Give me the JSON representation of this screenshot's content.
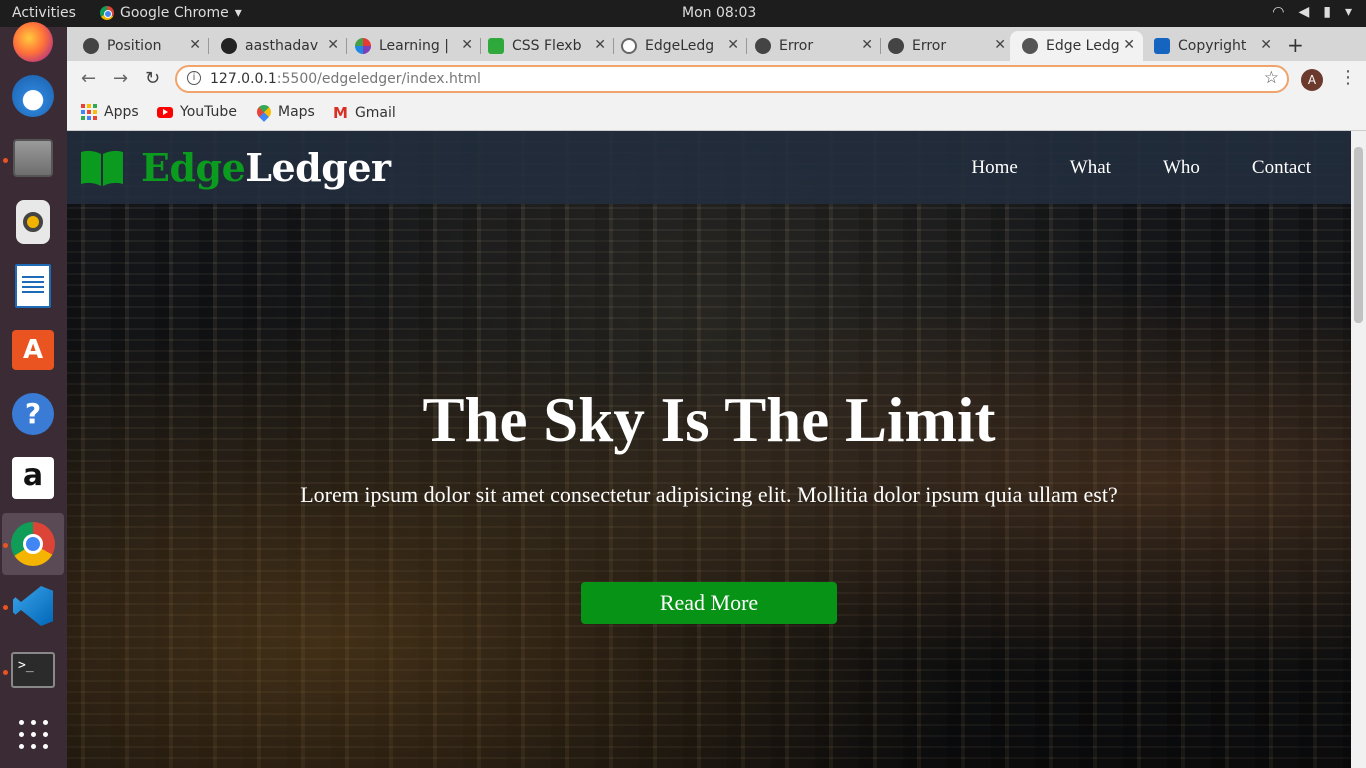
{
  "system": {
    "activities": "Activities",
    "app_name": "Google Chrome",
    "app_menu_arrow": "▾",
    "clock": "Mon 08:03"
  },
  "tabs": [
    {
      "title": "Position",
      "fav_color": "#444444"
    },
    {
      "title": "aasthadav",
      "fav_color": "#222222"
    },
    {
      "title": "Learning |",
      "fav_color": "#7b3fb8"
    },
    {
      "title": "CSS Flexb",
      "fav_color": "#2eaa3c"
    },
    {
      "title": "EdgeLedg",
      "fav_color": "#666666"
    },
    {
      "title": "Error",
      "fav_color": "#444444"
    },
    {
      "title": "Error",
      "fav_color": "#444444"
    },
    {
      "title": "Edge Ledg",
      "fav_color": "#555555"
    },
    {
      "title": "Copyright",
      "fav_color": "#1565c0"
    }
  ],
  "omnibox": {
    "url_host": "127.0.0.1",
    "url_rest": ":5500/edgeledger/index.html"
  },
  "profile_initial": "A",
  "bookmarks": [
    {
      "label": "Apps",
      "icon": "apps-grid-icon"
    },
    {
      "label": "YouTube",
      "icon": "youtube-icon"
    },
    {
      "label": "Maps",
      "icon": "maps-icon"
    },
    {
      "label": "Gmail",
      "icon": "gmail-icon"
    }
  ],
  "site": {
    "logo_green": "Edge",
    "logo_white": "Ledger",
    "nav": [
      "Home",
      "What",
      "Who",
      "Contact"
    ],
    "hero_title": "The Sky Is The Limit",
    "hero_subtitle": "Lorem ipsum dolor sit amet consectetur adipisicing elit. Mollitia dolor ipsum quia ullam est?",
    "cta_label": "Read More",
    "accent": "#079416"
  },
  "dock": [
    "firefox",
    "thunderbird",
    "files",
    "rhythmbox",
    "writer",
    "software",
    "help",
    "amazon",
    "chrome",
    "vscode",
    "terminal",
    "show-apps"
  ]
}
